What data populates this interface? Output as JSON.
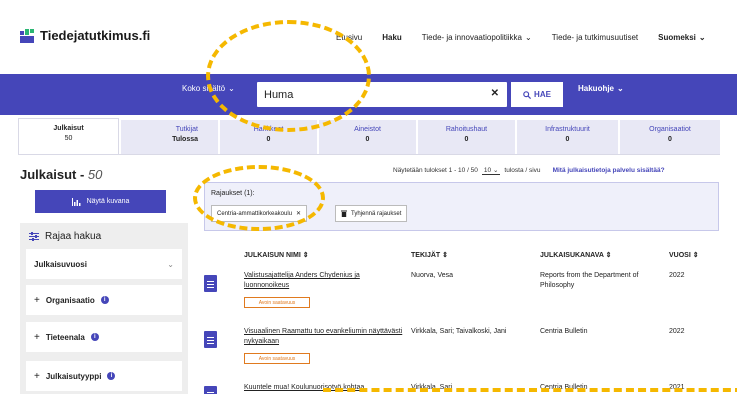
{
  "header": {
    "logo_text": "Tiedejatutkimus.fi",
    "nav": [
      {
        "label": "Etusivu",
        "bold": false,
        "has_dropdown": false
      },
      {
        "label": "Haku",
        "bold": true,
        "has_dropdown": false
      },
      {
        "label": "Tiede- ja innovaatiopolitiikka",
        "bold": false,
        "has_dropdown": true
      },
      {
        "label": "Tiede- ja tutkimusuutiset",
        "bold": false,
        "has_dropdown": false
      },
      {
        "label": "Suomeksi",
        "bold": true,
        "has_dropdown": true
      }
    ]
  },
  "search": {
    "scope_label": "Koko sisältö",
    "query": "Huma",
    "clear_icon": "close-icon",
    "search_button": "HAE",
    "help_label": "Hakuohje"
  },
  "tabs": [
    {
      "name": "Julkaisut",
      "count": "50",
      "active": true
    },
    {
      "name": "Tutkijat",
      "count": "Tulossa",
      "active": false
    },
    {
      "name": "Hankkeet",
      "count": "0",
      "active": false
    },
    {
      "name": "Aineistot",
      "count": "0",
      "active": false
    },
    {
      "name": "Rahoitushaut",
      "count": "0",
      "active": false
    },
    {
      "name": "Infrastruktuurit",
      "count": "0",
      "active": false
    },
    {
      "name": "Organisaatiot",
      "count": "0",
      "active": false
    }
  ],
  "results": {
    "title": "Julkaisut - ",
    "count": "50",
    "showing_text": "Näytetään tulokset 1 - 10 / 50",
    "page_size": "10",
    "per_page_text": "tulosta / sivu",
    "info_link": "Mitä julkaisutietoja palvelu sisältää?"
  },
  "sidebar": {
    "visual_button": "Näytä kuvana",
    "refine_title": "Rajaa hakua",
    "facets": [
      {
        "label": "Julkaisuvuosi",
        "expanded": true
      },
      {
        "label": "Organisaatio",
        "expanded": false
      },
      {
        "label": "Tieteenala",
        "expanded": false
      },
      {
        "label": "Julkaisutyyppi",
        "expanded": false
      }
    ]
  },
  "filters": {
    "label": "Rajaukset (1):",
    "active_filter": "Centria-ammattikorkeakoulu",
    "clear_button": "Tyhjennä rajaukset"
  },
  "table": {
    "columns": [
      "JULKAISUN NIMI",
      "TEKIJÄT",
      "JULKAISUKANAVA",
      "VUOSI"
    ],
    "rows": [
      {
        "title": "Valistusajattelija Anders Chydenius ja luonnonoikeus",
        "oa_badge": "Avoin saatavuus",
        "authors": "Nuorva, Vesa",
        "channel": "Reports from the Department of Philosophy",
        "year": "2022"
      },
      {
        "title": "Visuaalinen Raamattu tuo evankeliumin näyttävästi nykyaikaan",
        "oa_badge": "Avoin saatavuus",
        "authors": "Virkkala, Sari; Taivalkoski, Jani",
        "channel": "Centria Bulletin",
        "year": "2022"
      },
      {
        "title": "Kuuntele mua! Koulunuorisotyö kohtaa",
        "oa_badge": "",
        "authors": "Virkkala, Sari",
        "channel": "Centria Bulletin",
        "year": "2021"
      }
    ]
  },
  "colors": {
    "brand": "#4546b9",
    "annotation": "#f5b800",
    "badge": "#e07a1f"
  }
}
